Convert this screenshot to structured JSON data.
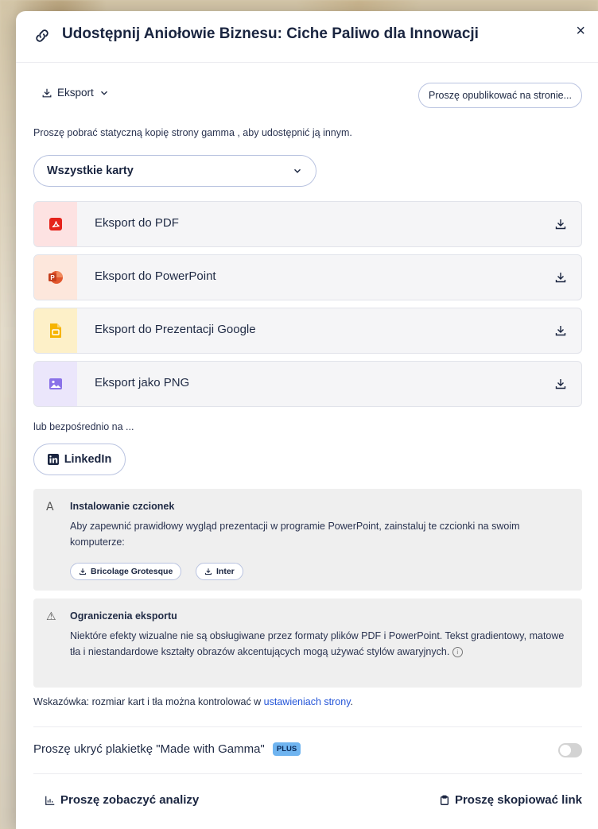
{
  "dialog": {
    "title": "Udostępnij Aniołowie Biznesu: Ciche Paliwo dla Innowacji",
    "close_label": "×"
  },
  "toolbar": {
    "export_label": "Eksport",
    "publish_label": "Proszę opublikować na stronie..."
  },
  "subtitle": "Proszę pobrać statyczną kopię strony gamma , aby udostępnić ją innym.",
  "card_select": {
    "value": "Wszystkie karty"
  },
  "exports": [
    {
      "label": "Eksport do PDF",
      "icon": "pdf-icon",
      "bg": "#fde2e2"
    },
    {
      "label": "Eksport do PowerPoint",
      "icon": "powerpoint-icon",
      "bg": "#fde7dc"
    },
    {
      "label": "Eksport do Prezentacji Google",
      "icon": "google-slides-icon",
      "bg": "#fdf0c8"
    },
    {
      "label": "Eksport jako PNG",
      "icon": "image-icon",
      "bg": "#ebe6fb"
    }
  ],
  "share": {
    "or_text": "lub bezpośrednio na ...",
    "linkedin_label": "LinkedIn"
  },
  "fonts_box": {
    "title": "Instalowanie czcionek",
    "text": "Aby zapewnić prawidłowy wygląd prezentacji w programie PowerPoint, zainstaluj te czcionki na swoim komputerze:",
    "fonts": [
      "Bricolage Grotesque",
      "Inter"
    ]
  },
  "limits_box": {
    "title": "Ograniczenia eksportu",
    "text": "Niektóre efekty wizualne nie są obsługiwane przez formaty plików PDF i PowerPoint. Tekst gradientowy, matowe tła i niestandardowe kształty obrazów akcentujących mogą używać stylów awaryjnych."
  },
  "tip": {
    "text": "Wskazówka: rozmiar kart i tła można kontrolować w ",
    "link": "ustawieniach strony",
    "suffix": "."
  },
  "badge_row": {
    "label": "Proszę ukryć plakietkę \"Made with Gamma\"",
    "plus": "PLUS",
    "toggle_on": false
  },
  "footer": {
    "analytics_label": "Proszę zobaczyć analizy",
    "copy_label": "Proszę skopiować link"
  }
}
